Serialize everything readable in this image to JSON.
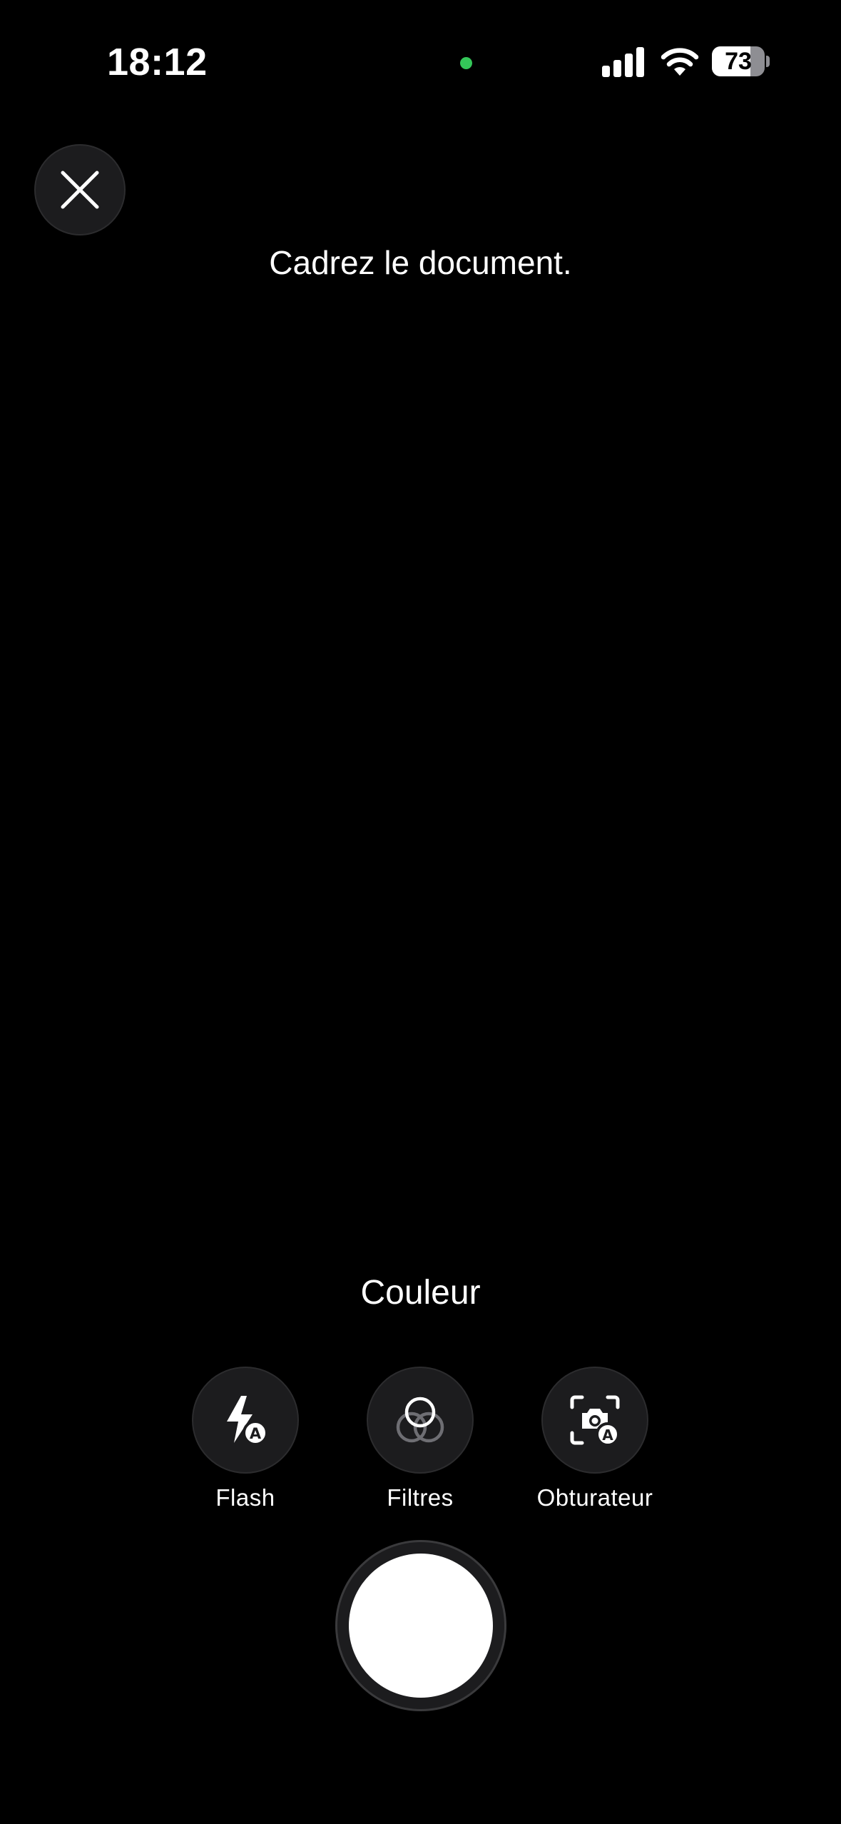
{
  "status_bar": {
    "time": "18:12",
    "battery_percent": "73",
    "battery_level": 0.73,
    "privacy_indicator_color": "#34c759",
    "signal_icon": "cellular-signal-icon",
    "wifi_icon": "wifi-icon"
  },
  "header": {
    "close_icon": "close-icon",
    "instruction": "Cadrez le document."
  },
  "capture": {
    "mode_label": "Couleur",
    "tools": [
      {
        "label": "Flash",
        "icon": "flash-auto-icon"
      },
      {
        "label": "Filtres",
        "icon": "filters-icon"
      },
      {
        "label": "Obturateur",
        "icon": "auto-shutter-icon"
      }
    ],
    "shutter_icon": "shutter-button"
  },
  "colors": {
    "background": "#000000",
    "button_background": "#1c1c1e",
    "text": "#ffffff"
  }
}
